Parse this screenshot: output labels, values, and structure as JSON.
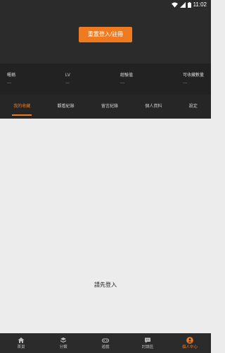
{
  "status_bar": {
    "time": "11:02",
    "icons": [
      "wifi-icon",
      "signal-icon",
      "battery-icon"
    ]
  },
  "header": {
    "login_button_label": "重置登入/註冊"
  },
  "stats": [
    {
      "label": "暱稱",
      "value": "—"
    },
    {
      "label": "LV",
      "value": "—"
    },
    {
      "label": "經驗值",
      "value": "—"
    },
    {
      "label": "可收藏數量",
      "value": "—"
    }
  ],
  "tabs": [
    {
      "label": "我的收藏",
      "active": true
    },
    {
      "label": "觀看紀錄",
      "active": false
    },
    {
      "label": "留言紀錄",
      "active": false
    },
    {
      "label": "個人資料",
      "active": false
    },
    {
      "label": "設定",
      "active": false
    }
  ],
  "content": {
    "empty_message": "請先登入"
  },
  "bottom_nav": [
    {
      "label": "首頁",
      "icon": "home-icon",
      "active": false
    },
    {
      "label": "分類",
      "icon": "category-icon",
      "active": false
    },
    {
      "label": "遊戲",
      "icon": "gamepad-icon",
      "active": false
    },
    {
      "label": "討論區",
      "icon": "chat-icon",
      "active": false
    },
    {
      "label": "個人中心",
      "icon": "user-icon",
      "active": true
    }
  ],
  "colors": {
    "accent": "#f07a1f",
    "header_bg": "#2b2b2b",
    "content_bg": "#ececec"
  }
}
